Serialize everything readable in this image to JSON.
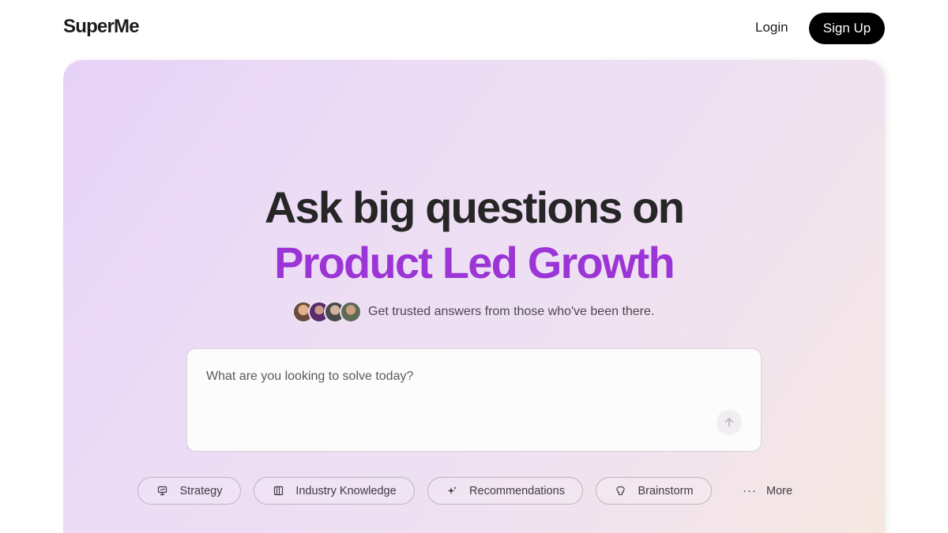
{
  "header": {
    "logo": "SuperMe",
    "login_label": "Login",
    "signup_label": "Sign Up"
  },
  "hero": {
    "headline_line1": "Ask big questions on",
    "headline_line2": "Product Led Growth",
    "trust_text": "Get trusted answers from those who've been there.",
    "accent_color": "#9b35d6"
  },
  "ask": {
    "placeholder": "What are you looking to solve today?",
    "value": ""
  },
  "chips": [
    {
      "label": "Strategy",
      "icon": "presentation-icon"
    },
    {
      "label": "Industry Knowledge",
      "icon": "book-icon"
    },
    {
      "label": "Recommendations",
      "icon": "sparkle-icon"
    },
    {
      "label": "Brainstorm",
      "icon": "brain-icon"
    }
  ],
  "more_label": "More"
}
